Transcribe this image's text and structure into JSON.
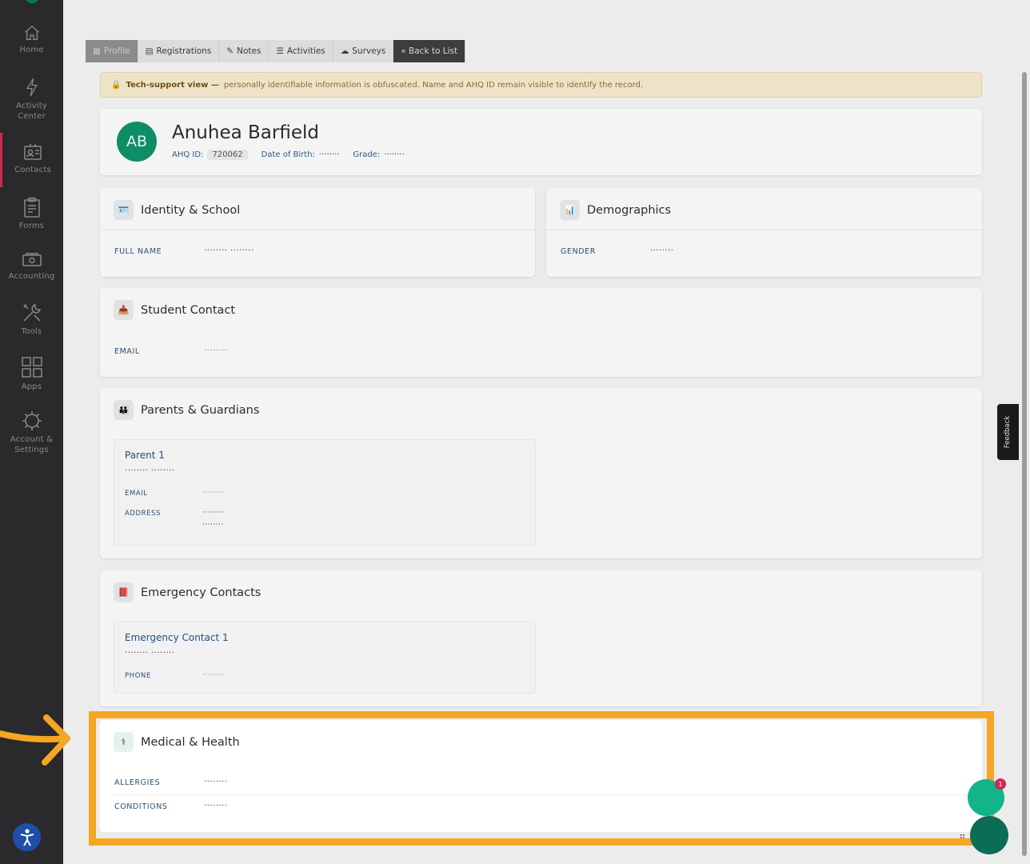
{
  "sidebar": {
    "items": [
      {
        "label": "Home",
        "icon": "home-icon"
      },
      {
        "label": "Activity Center",
        "icon": "lightning-icon"
      },
      {
        "label": "Contacts",
        "icon": "contacts-icon"
      },
      {
        "label": "Forms",
        "icon": "clipboard-icon"
      },
      {
        "label": "Accounting",
        "icon": "money-icon"
      },
      {
        "label": "Tools",
        "icon": "tools-icon"
      },
      {
        "label": "Apps",
        "icon": "apps-grid-icon"
      },
      {
        "label": "Account & Settings",
        "icon": "gear-icon"
      }
    ],
    "active_item": "Contacts",
    "active_color": "#d0294e"
  },
  "tabs": [
    {
      "label": "Profile",
      "icon": "profile-icon"
    },
    {
      "label": "Registrations",
      "icon": "clipboard-icon"
    },
    {
      "label": "Notes",
      "icon": "edit-icon"
    },
    {
      "label": "Activities",
      "icon": "list-icon"
    },
    {
      "label": "Surveys",
      "icon": "cloud-icon"
    },
    {
      "label": "« Back to List"
    }
  ],
  "banner": {
    "bold": "Tech-support view —",
    "text": "personally identifiable information is obfuscated. Name and AHQ ID remain visible to identify the record."
  },
  "profile": {
    "initials": "AB",
    "name": "Anuhea Barfield",
    "ahq_label": "AHQ ID:",
    "ahq_id": "720062",
    "dob_label": "Date of Birth:",
    "dob_value": "········",
    "grade_label": "Grade:",
    "grade_value": "········"
  },
  "identity": {
    "title": "Identity & School",
    "full_name_label": "FULL NAME",
    "full_name_value": "········ ········"
  },
  "demographics": {
    "title": "Demographics",
    "gender_label": "GENDER",
    "gender_value": "········"
  },
  "student_contact": {
    "title": "Student Contact",
    "email_label": "EMAIL",
    "email_value": "········"
  },
  "parents": {
    "title": "Parents & Guardians",
    "parent1": {
      "title": "Parent 1",
      "name": "········ ········",
      "email_label": "EMAIL",
      "email_value": "········",
      "address_label": "ADDRESS",
      "address_line1": "········",
      "address_line2": "········"
    }
  },
  "emergency": {
    "title": "Emergency Contacts",
    "contact1": {
      "title": "Emergency Contact 1",
      "name": "········ ········",
      "phone_label": "PHONE",
      "phone_value": "········"
    }
  },
  "medical": {
    "title": "Medical & Health",
    "allergies_label": "ALLERGIES",
    "allergies_value": "········",
    "conditions_label": "CONDITIONS",
    "conditions_value": "········"
  },
  "feedback": {
    "label": "Feedback"
  },
  "chat": {
    "badge": "1"
  },
  "colors": {
    "highlight": "#f5a623",
    "avatar": "#0e8d66",
    "chat": "#12b48a"
  }
}
